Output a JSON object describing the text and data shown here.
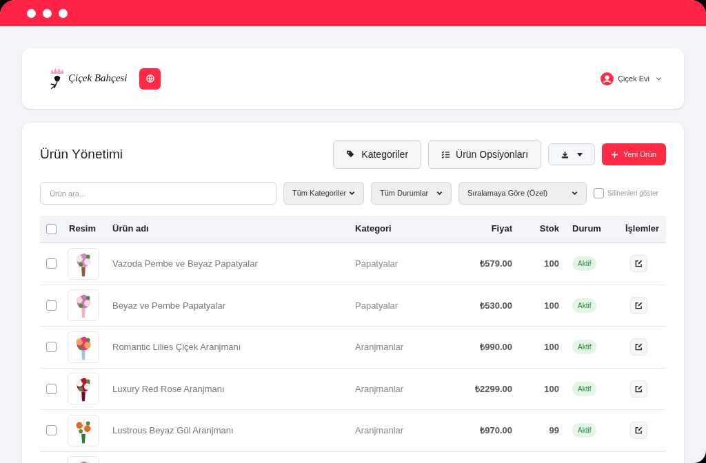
{
  "header": {
    "logo_text": "Çiçek Bahçesi",
    "user": {
      "name": "Çiçek Evi"
    }
  },
  "page": {
    "title": "Ürün Yönetimi",
    "buttons": [
      {
        "kind": "categories",
        "label": "Kategoriler"
      },
      {
        "kind": "options",
        "label": "Ürün Opsiyonları"
      },
      {
        "kind": "export"
      },
      {
        "kind": "primary",
        "label": "Yeni Ürün"
      }
    ],
    "search": {
      "placeholder": "Ürün ara..."
    },
    "filters": [
      {
        "label": "Tüm Kategoriler"
      },
      {
        "label": "Tüm Durumlar"
      },
      {
        "label": "Sıralamaya Göre (Özel)"
      }
    ],
    "show_deleted": {
      "label": "Silinenleri göster",
      "checked": false
    }
  },
  "table": {
    "select_all": {
      "checked": false
    },
    "columns": [
      "Resim",
      "Ürün adı",
      "Kategori",
      "Fiyat",
      "Stok",
      "Durum",
      "İşlemler"
    ],
    "rows": [
      {
        "checked": false,
        "name": "Vazoda Pembe ve Beyaz Papatyalar",
        "category": "Papatyalar",
        "price": "₺579.00",
        "stock": "100",
        "status": "Aktif",
        "active": true
      },
      {
        "checked": false,
        "name": "Beyaz ve Pembe Papatyalar",
        "category": "Papatyalar",
        "price": "₺530.00",
        "stock": "100",
        "status": "Aktif",
        "active": true
      },
      {
        "checked": false,
        "name": "Romantic Lilies Çiçek Aranjmanı",
        "category": "Aranjmanlar",
        "price": "₺990.00",
        "stock": "100",
        "status": "Aktif",
        "active": true
      },
      {
        "checked": false,
        "name": "Luxury Red Rose Aranjmanı",
        "category": "Aranjmanlar",
        "price": "₺2299.00",
        "stock": "100",
        "status": "Aktif",
        "active": true
      },
      {
        "checked": false,
        "name": "Lustrous Beyaz Gül Aranjmanı",
        "category": "Aranjmanlar",
        "price": "₺970.00",
        "stock": "99",
        "status": "Aktif",
        "active": true
      }
    ]
  }
}
